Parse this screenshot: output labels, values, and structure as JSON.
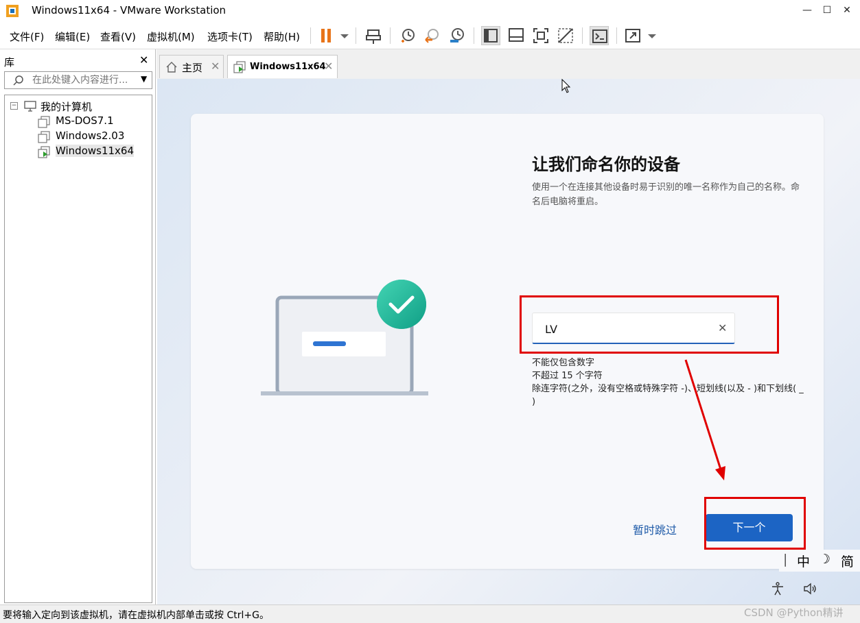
{
  "window": {
    "title": "Windows11x64 - VMware Workstation",
    "minimize": "—",
    "maximize": "☐",
    "close": "✕"
  },
  "menu": [
    "文件(F)",
    "编辑(E)",
    "查看(V)",
    "虚拟机(M)",
    "选项卡(T)",
    "帮助(H)"
  ],
  "toolbar": {
    "icons": [
      "pause-icon",
      "send-keys-icon",
      "snapshot-icon",
      "revert-snapshot-icon",
      "snapshot-manager-icon",
      "library-view-icon",
      "thumbnail-view-icon",
      "fullscreen-fit-icon",
      "unity-icon",
      "console-icon",
      "fullscreen-icon"
    ],
    "accent": "#e8741a"
  },
  "library": {
    "title": "库",
    "close": "✕",
    "search_placeholder": "在此处键入内容进行...",
    "tree": {
      "root": "我的计算机",
      "items": [
        "MS-DOS7.1",
        "Windows2.03",
        "Windows11x64"
      ],
      "selected": "Windows11x64"
    }
  },
  "tabs": [
    {
      "label": "主页",
      "active": false
    },
    {
      "label": "Windows11x64",
      "active": true
    }
  ],
  "oobe": {
    "title": "让我们命名你的设备",
    "subtitle": "使用一个在连接其他设备时易于识别的唯一名称作为自己的名称。命名后电脑将重启。",
    "input_value": "LV",
    "clear": "✕",
    "rules": [
      "不能仅包含数字",
      "不超过 15 个字符",
      "除连字符(之外，没有空格或特殊字符 -)、短划线(以及 - )和下划线( _ )"
    ],
    "skip": "暂时跳过",
    "next": "下一个",
    "accent": "#1c64c4"
  },
  "ime": {
    "cursor": "|",
    "lang": "中",
    "moon": "☽",
    "mode": "简"
  },
  "statusbar": {
    "text": "要将输入定向到该虚拟机，请在虚拟机内部单击或按 Ctrl+G。",
    "watermark": "CSDN @Python精讲"
  },
  "annotation_color": "#e00000"
}
